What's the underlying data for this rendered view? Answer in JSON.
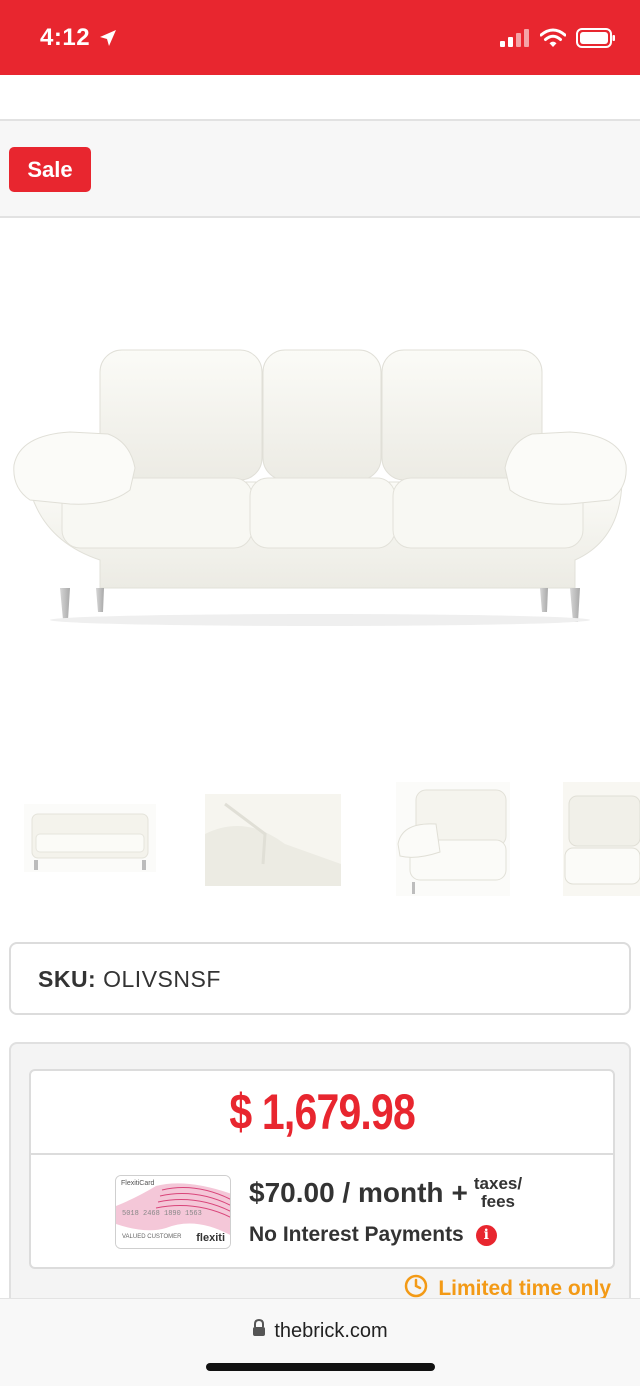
{
  "status_bar": {
    "time": "4:12",
    "background": "#e8262f",
    "icons": [
      "location-arrow-icon",
      "signal-icon",
      "wifi-icon",
      "battery-icon"
    ]
  },
  "badge": {
    "label": "Sale"
  },
  "product": {
    "image": "white-leather-sofa",
    "thumbnails": [
      "sofa-front-thumbnail",
      "sofa-detail-thumbnail",
      "sofa-angle-thumbnail",
      "sofa-side-thumbnail"
    ]
  },
  "sku": {
    "label": "SKU:",
    "value": "OLIVSNSF"
  },
  "pricing": {
    "price": "$ 1,679.98",
    "monthly": "$70.00 / month",
    "plus": "+",
    "taxes_line1": "taxes/",
    "taxes_line2": "fees",
    "no_interest": "No Interest Payments",
    "limited": "Limited time only",
    "card_brand_small": "FlexitiCard",
    "card_number": "5018 2468 1890 1563",
    "card_holder": "VALUED CUSTOMER",
    "card_brand": "flexiti",
    "accent": "#e8262f",
    "promo_color": "#f39a16"
  },
  "browser": {
    "url": "thebrick.com"
  }
}
